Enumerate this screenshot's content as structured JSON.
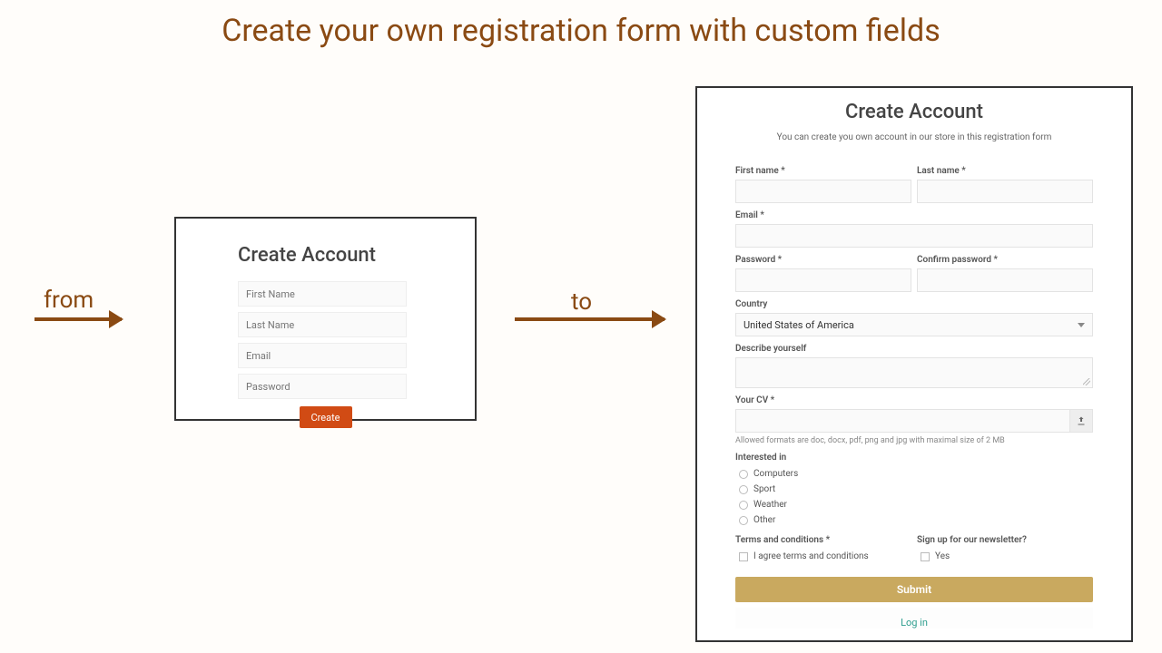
{
  "title": "Create your own registration form with custom fields",
  "annotations": {
    "from": "from",
    "to": "to"
  },
  "simple": {
    "heading": "Create Account",
    "placeholders": {
      "first": "First Name",
      "last": "Last Name",
      "email": "Email",
      "password": "Password"
    },
    "button": "Create"
  },
  "custom": {
    "heading": "Create Account",
    "subtitle": "You can create you own account in our store in this registration form",
    "labels": {
      "first": "First name *",
      "last": "Last name *",
      "email": "Email *",
      "password": "Password *",
      "confirm": "Confirm password *",
      "country": "Country",
      "describe": "Describe yourself",
      "cv": "Your CV *",
      "interested": "Interested in",
      "terms": "Terms and conditions *",
      "newsletter": "Sign up for our newsletter?"
    },
    "country_value": "United States of America",
    "cv_hint": "Allowed formats are doc, docx, pdf, png and jpg with maximal size of 2 MB",
    "interests": [
      "Computers",
      "Sport",
      "Weather",
      "Other"
    ],
    "terms_check": "I agree terms and conditions",
    "newsletter_check": "Yes",
    "submit": "Submit",
    "login": "Log in"
  }
}
